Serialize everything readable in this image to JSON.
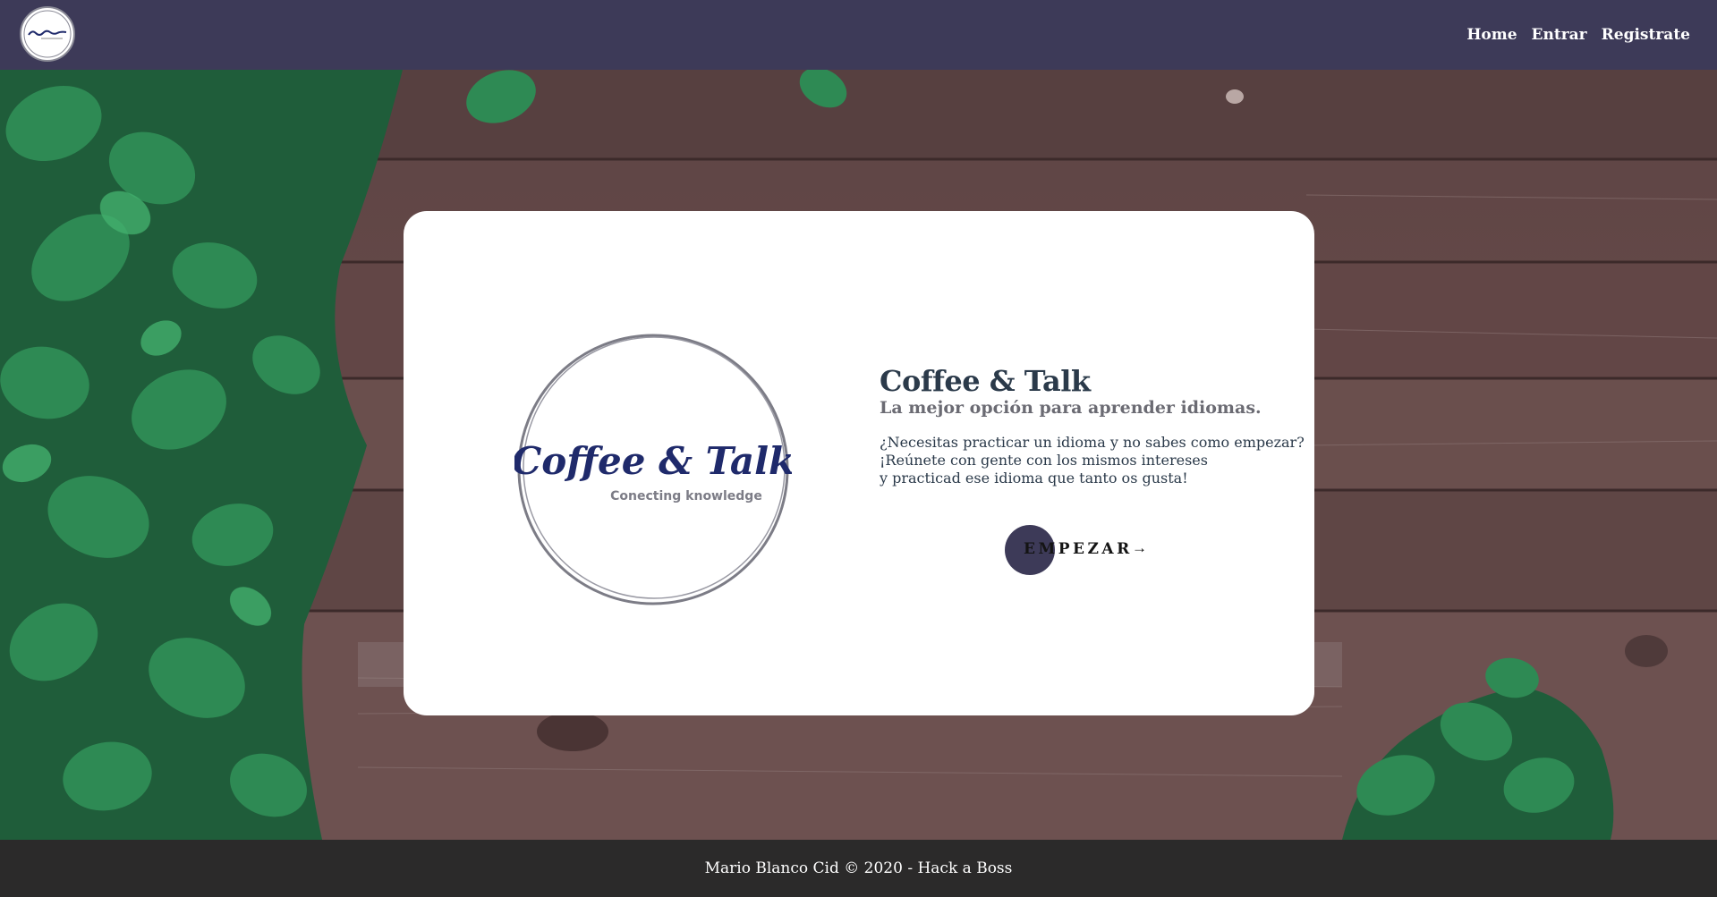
{
  "nav": {
    "logo_alt": "Coffee & Talk",
    "links": [
      "Home",
      "Entrar",
      "Registrate"
    ]
  },
  "card": {
    "logo_title": "Coffee & Talk",
    "logo_tagline": "Conecting knowledge",
    "title": "Coffee & Talk",
    "subtitle": "La mejor opción para aprender idiomas.",
    "description": [
      "¿Necesitas practicar un idioma y no sabes como empezar?",
      "¡Reúnete con gente con los mismos intereses",
      "y practicad ese idioma que tanto os gusta!"
    ],
    "button_label": "EMPEZAR",
    "button_icon": "arrow-right-icon",
    "button_arrow": "→"
  },
  "footer": {
    "text": "Mario Blanco Cid © 2020 - Hack a Boss"
  },
  "colors": {
    "navbar": "#3d3a58",
    "footer": "#2b2a2a",
    "accent": "#3d3a58",
    "title": "#2b3a4a",
    "subtitle": "#6b6b73",
    "logo_script": "#1f2a6b"
  }
}
